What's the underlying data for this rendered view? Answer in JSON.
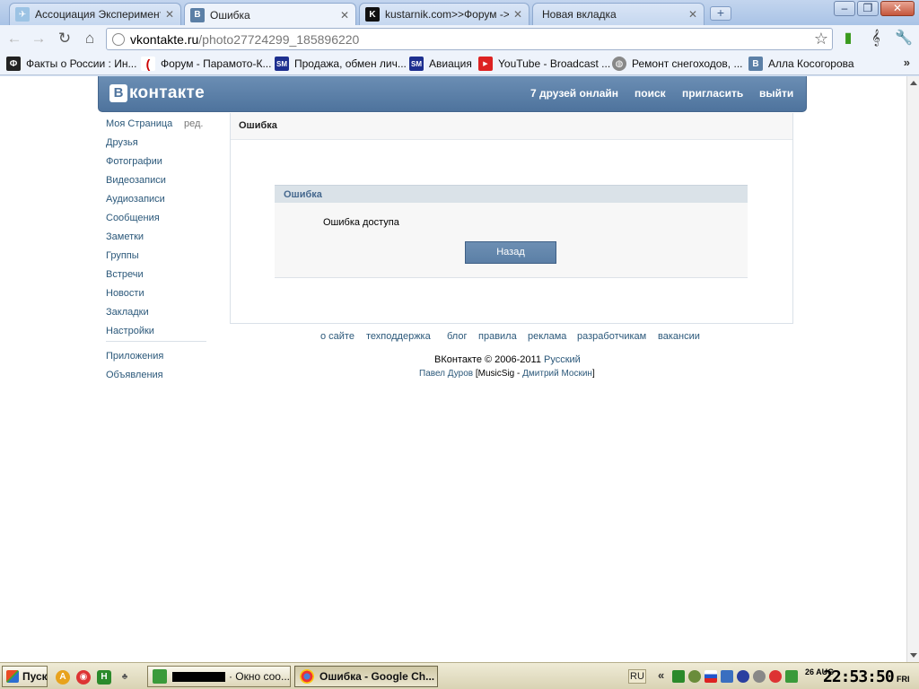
{
  "browser": {
    "tabs": [
      {
        "title": "Ассоциация Экспериментал",
        "favicon": "aeo-icon"
      },
      {
        "title": "Ошибка",
        "favicon": "vk-b-icon"
      },
      {
        "title": "kustarnik.com>>Форум -> Фо",
        "favicon": "k-icon"
      },
      {
        "title": "Новая вкладка",
        "favicon": ""
      }
    ],
    "new_tab_label": "+",
    "window_controls": {
      "minimize": "–",
      "restore": "❐",
      "close": "✕"
    },
    "address": {
      "domain": "vkontakte.ru",
      "path": "/photo27724299_185896220"
    },
    "bookmarks": [
      {
        "label": "Факты о России : Ин...",
        "icon": "phi-icon"
      },
      {
        "label": "Форум - Парамото-К...",
        "icon": "paramotor-icon"
      },
      {
        "label": "Продажа, обмен лич...",
        "icon": "sm-icon"
      },
      {
        "label": "Авиация",
        "icon": "sm-icon"
      },
      {
        "label": "YouTube - Broadcast ...",
        "icon": "youtube-icon"
      },
      {
        "label": "Ремонт снегоходов, ...",
        "icon": "globe-icon"
      },
      {
        "label": "Алла Косогорова",
        "icon": "vk-b-icon"
      }
    ],
    "bookmarks_more": "»"
  },
  "vk": {
    "logo_letter": "В",
    "logo_text": "контакте",
    "top_links": {
      "friends_online": "7 друзей онлайн",
      "search": "поиск",
      "invite": "пригласить",
      "logout": "выйти"
    },
    "menu": {
      "edit": "ред.",
      "items": [
        "Моя Страница",
        "Друзья",
        "Фотографии",
        "Видеозаписи",
        "Аудиозаписи",
        "Сообщения",
        "Заметки",
        "Группы",
        "Встречи",
        "Новости",
        "Закладки",
        "Настройки"
      ],
      "secondary": [
        "Приложения",
        "Объявления"
      ]
    },
    "main": {
      "title": "Ошибка",
      "error_box": {
        "title": "Ошибка",
        "message": "Ошибка доступа",
        "back_button": "Назад"
      }
    },
    "footer": {
      "links": [
        "о сайте",
        "техподдержка",
        "блог",
        "правила",
        "реклама",
        "разработчикам",
        "вакансии"
      ],
      "copyright": "ВКонтакте © 2006-2011",
      "language": "Русский",
      "credits_author": "Павел Дуров",
      "credits_mid": "[MusicSig - ",
      "credits_second": "Дмитрий Москин",
      "credits_end": "]"
    }
  },
  "taskbar": {
    "start_label": "Пуск",
    "tasks": [
      {
        "label": "· Окно соо...",
        "active": false
      },
      {
        "label": "Ошибка - Google Ch...",
        "active": true
      }
    ],
    "language": "RU",
    "tray_expand": "«",
    "clock": {
      "date": "26 AUG",
      "time": "22:53:50",
      "day": "FRI"
    }
  }
}
